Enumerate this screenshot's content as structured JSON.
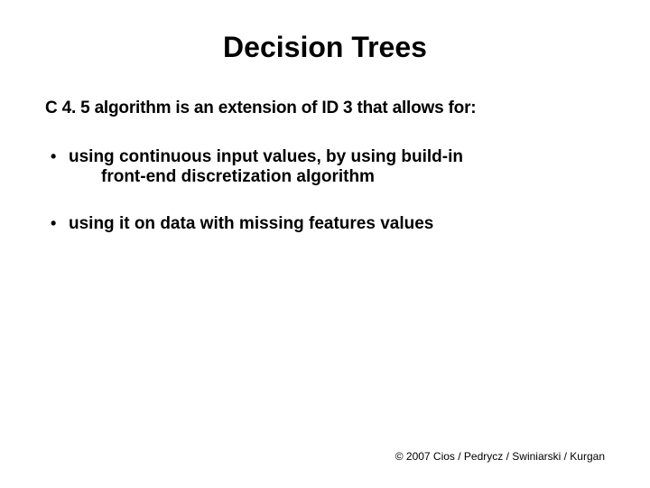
{
  "title": "Decision Trees",
  "intro": "C 4. 5 algorithm is an extension of ID 3 that allows for:",
  "bullets": [
    {
      "line1": "using continuous input values, by using build-in",
      "line2": "front-end discretization algorithm"
    },
    {
      "line1": "using it on data with missing features values",
      "line2": ""
    }
  ],
  "footer": "© 2007 Cios / Pedrycz / Swiniarski / Kurgan"
}
